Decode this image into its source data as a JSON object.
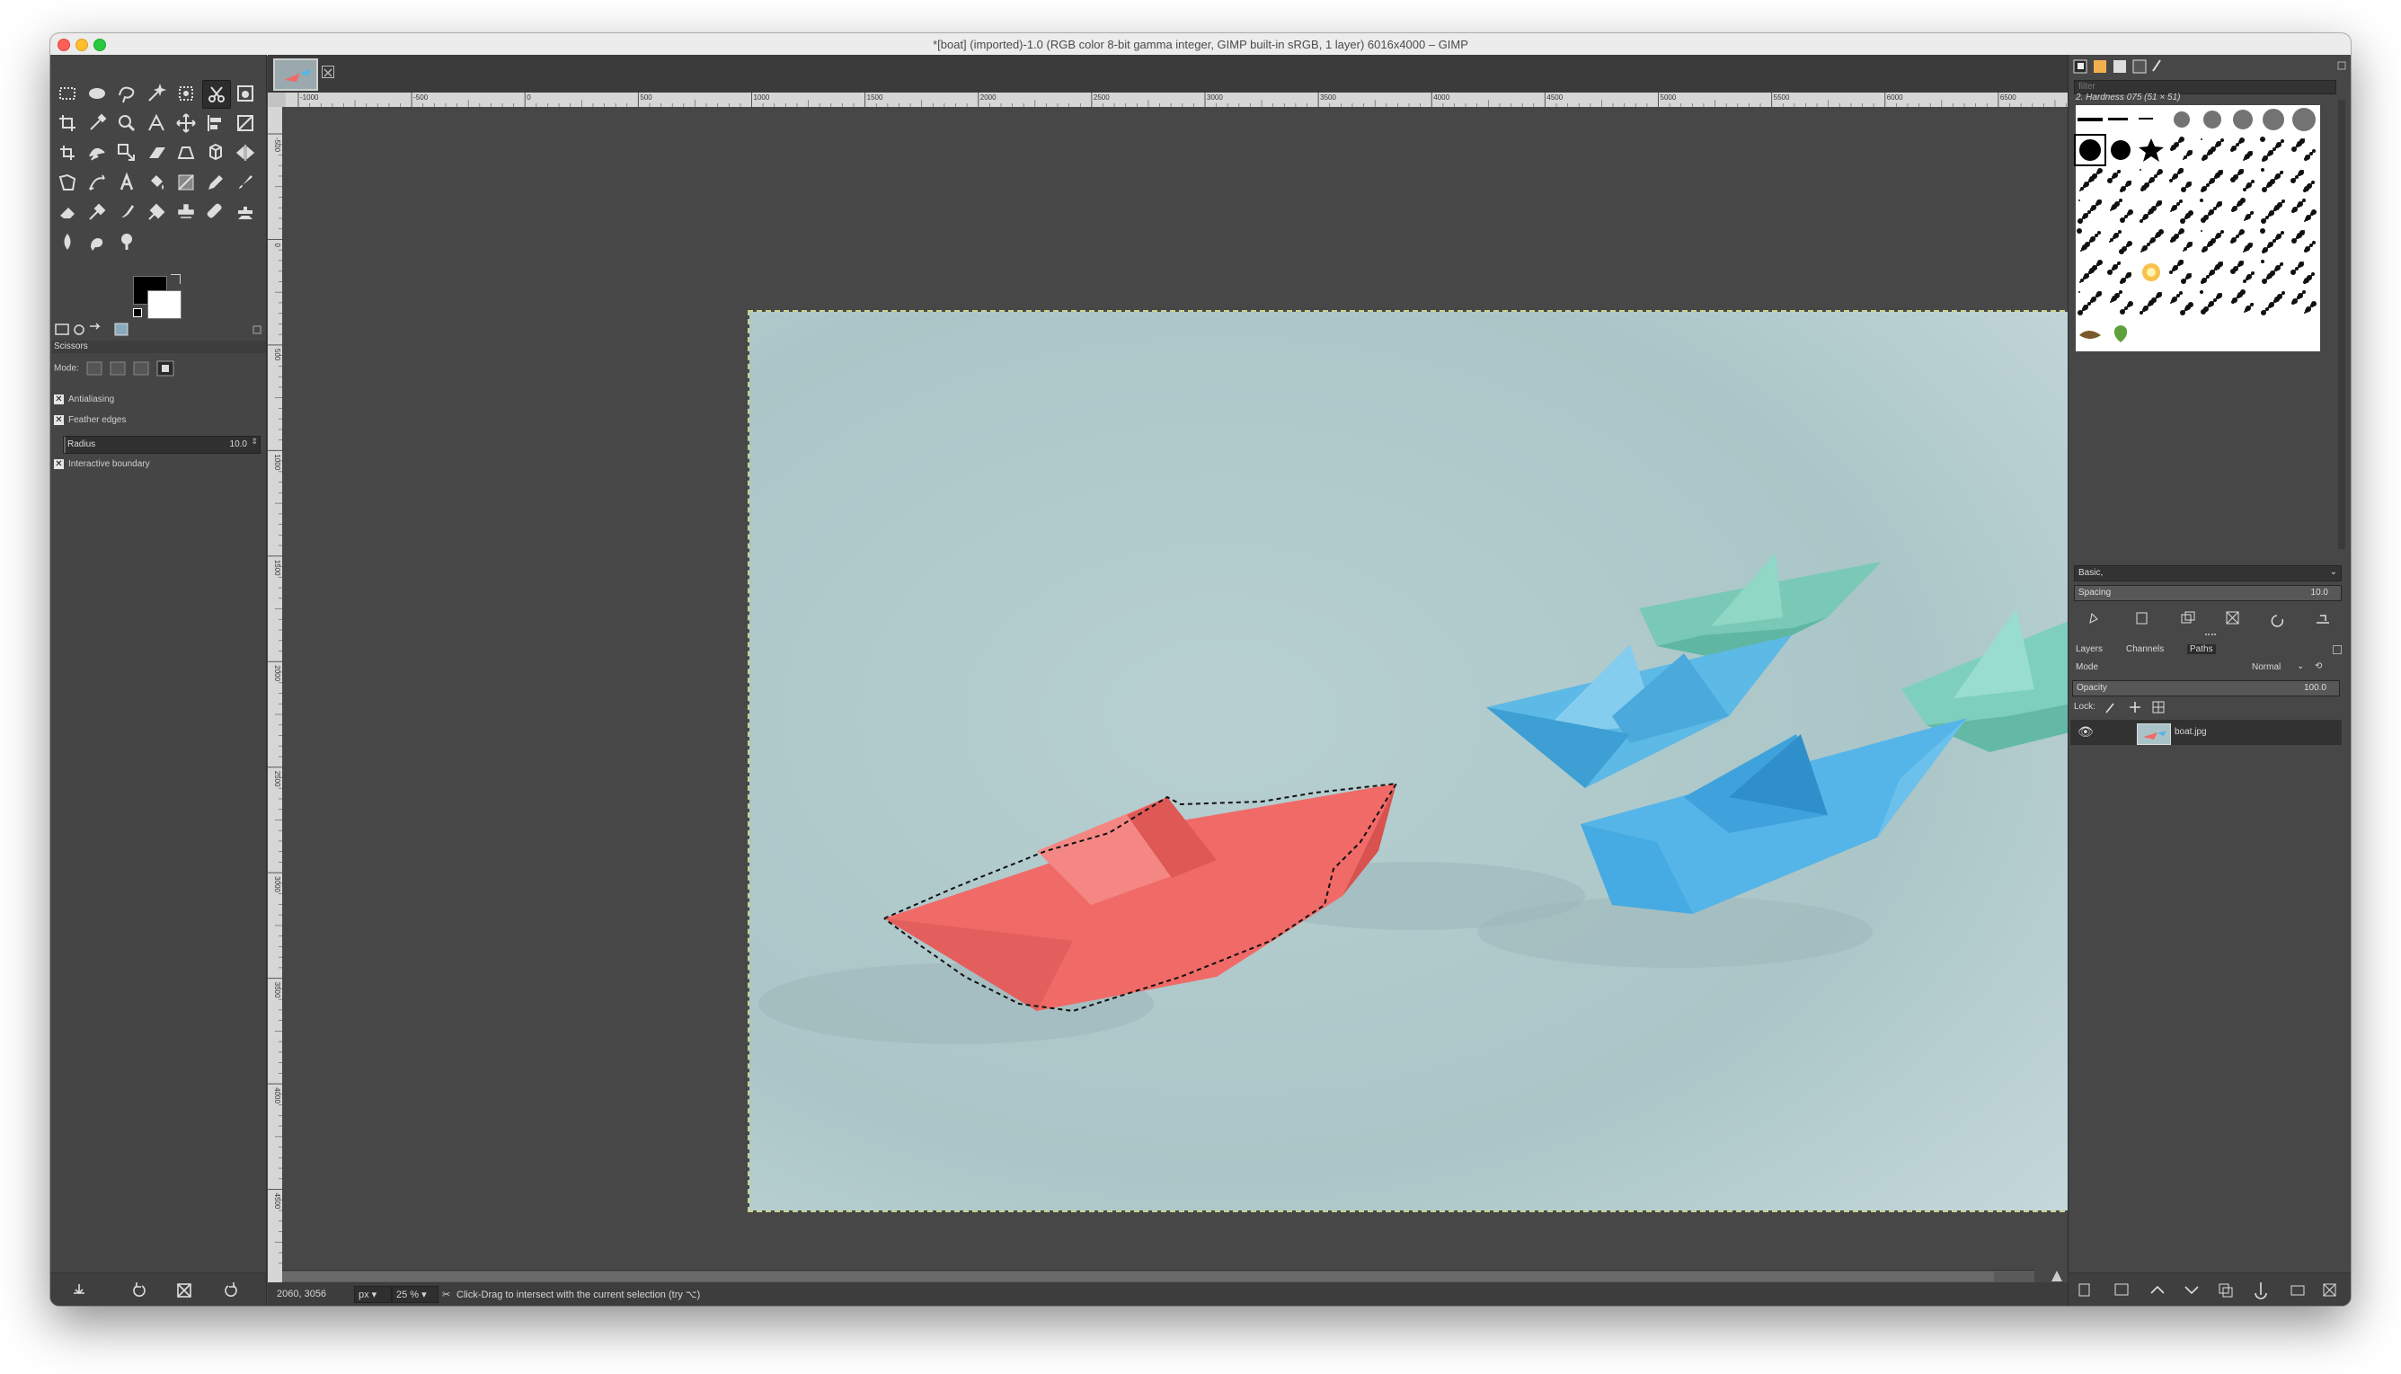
{
  "window": {
    "title": "*[boat] (imported)-1.0 (RGB color 8-bit gamma integer, GIMP built-in sRGB, 1 layer) 6016x4000 – GIMP"
  },
  "toolbox": {
    "active_tool": "scissors-select",
    "tools": [
      "rect-select",
      "ellipse-select",
      "free-select",
      "fuzzy-select",
      "by-color-select",
      "scissors-select",
      "foreground-select",
      "crop",
      "color-picker",
      "zoom",
      "measure",
      "move",
      "align",
      "transform",
      "unified-transform",
      "warp",
      "scale",
      "shear",
      "perspective",
      "3d-transform",
      "flip",
      "cage",
      "paths",
      "text",
      "bucket-fill",
      "gradient",
      "pencil",
      "paintbrush",
      "eraser",
      "airbrush",
      "ink",
      "mypaint",
      "clone",
      "heal",
      "perspective-clone",
      "blur",
      "smudge",
      "dodge-burn"
    ],
    "fg_color": "#000000",
    "bg_color": "#ffffff",
    "options": {
      "title": "Scissors",
      "mode_label": "Mode:",
      "antialiasing_label": "Antialiasing",
      "feather_label": "Feather edges",
      "radius_label": "Radius",
      "radius_value": "10.0",
      "interactive_label": "Interactive boundary"
    }
  },
  "ruler": {
    "h_labels": [
      "-1000",
      "-500",
      "0",
      "500",
      "1000",
      "1500",
      "2000",
      "2500",
      "3000",
      "3500",
      "4000",
      "4500",
      "5000",
      "5500",
      "6000",
      "6500"
    ],
    "v_labels": [
      "-500",
      "0",
      "500",
      "1000",
      "1500",
      "2000",
      "2500",
      "3000",
      "3500",
      "4000",
      "4500"
    ]
  },
  "status": {
    "coords": "2060, 3056",
    "unit": "px",
    "zoom": "25 %",
    "message": "Click-Drag to intersect with the current selection (try ⌥)"
  },
  "brushes": {
    "filter_placeholder": "filter",
    "selected_name": "2. Hardness 075 (51 × 51)",
    "preset": "Basic,",
    "spacing_label": "Spacing",
    "spacing_value": "10.0"
  },
  "layers": {
    "tabs": [
      "Layers",
      "Channels",
      "Paths"
    ],
    "mode_label": "Mode",
    "mode_value": "Normal",
    "opacity_label": "Opacity",
    "opacity_value": "100.0",
    "lock_label": "Lock:",
    "items": [
      {
        "name": "boat.jpg"
      }
    ]
  },
  "colors": {
    "window_bg": "#454545",
    "ruler": "#d6d6d6",
    "photo_bg": "#b9d0d2",
    "boat_red": "#f06a67",
    "boat_blue": "#54b6e6",
    "boat_teal": "#7fcfbf",
    "selection": "#c8d38c"
  }
}
